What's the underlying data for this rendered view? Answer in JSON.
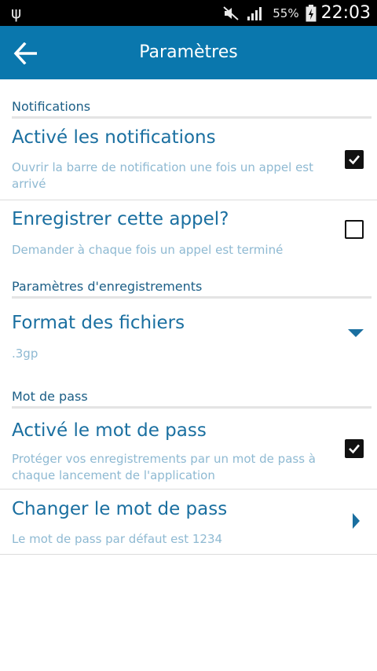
{
  "status_bar": {
    "battery_percent": "55%",
    "time": "22:03",
    "icons": [
      "usb-icon",
      "mute-icon",
      "signal-icon",
      "battery-charging-icon"
    ]
  },
  "app_bar": {
    "title": "Paramètres",
    "back_icon": "arrow-left-icon",
    "background": "#0a77ad"
  },
  "sections": [
    {
      "header": "Notifications",
      "items": [
        {
          "title": "Activé les notifications",
          "summary": "Ouvrir la barre de notification une fois un appel est arrivé",
          "widget": "checkbox",
          "checked": true
        },
        {
          "title": "Enregistrer cette appel?",
          "summary": "Demander à chaque fois un appel est terminé",
          "widget": "checkbox",
          "checked": false
        }
      ]
    },
    {
      "header": "Paramètres d'enregistrements",
      "items": [
        {
          "title": "Format des fichiers",
          "summary": ".3gp",
          "widget": "dropdown"
        }
      ]
    },
    {
      "header": "Mot de pass",
      "items": [
        {
          "title": "Activé le mot de pass",
          "summary": "Protéger vos enregistrements par un mot de pass à chaque lancement de l'application",
          "widget": "checkbox",
          "checked": true
        },
        {
          "title": "Changer le mot de pass",
          "summary": "Le mot de pass par défaut est 1234",
          "widget": "chevron"
        }
      ]
    }
  ],
  "colors": {
    "accent": "#0a77ad",
    "title_text": "#1a6fa0",
    "summary_text": "#8eb9d2",
    "header_text": "#1b5e86"
  }
}
